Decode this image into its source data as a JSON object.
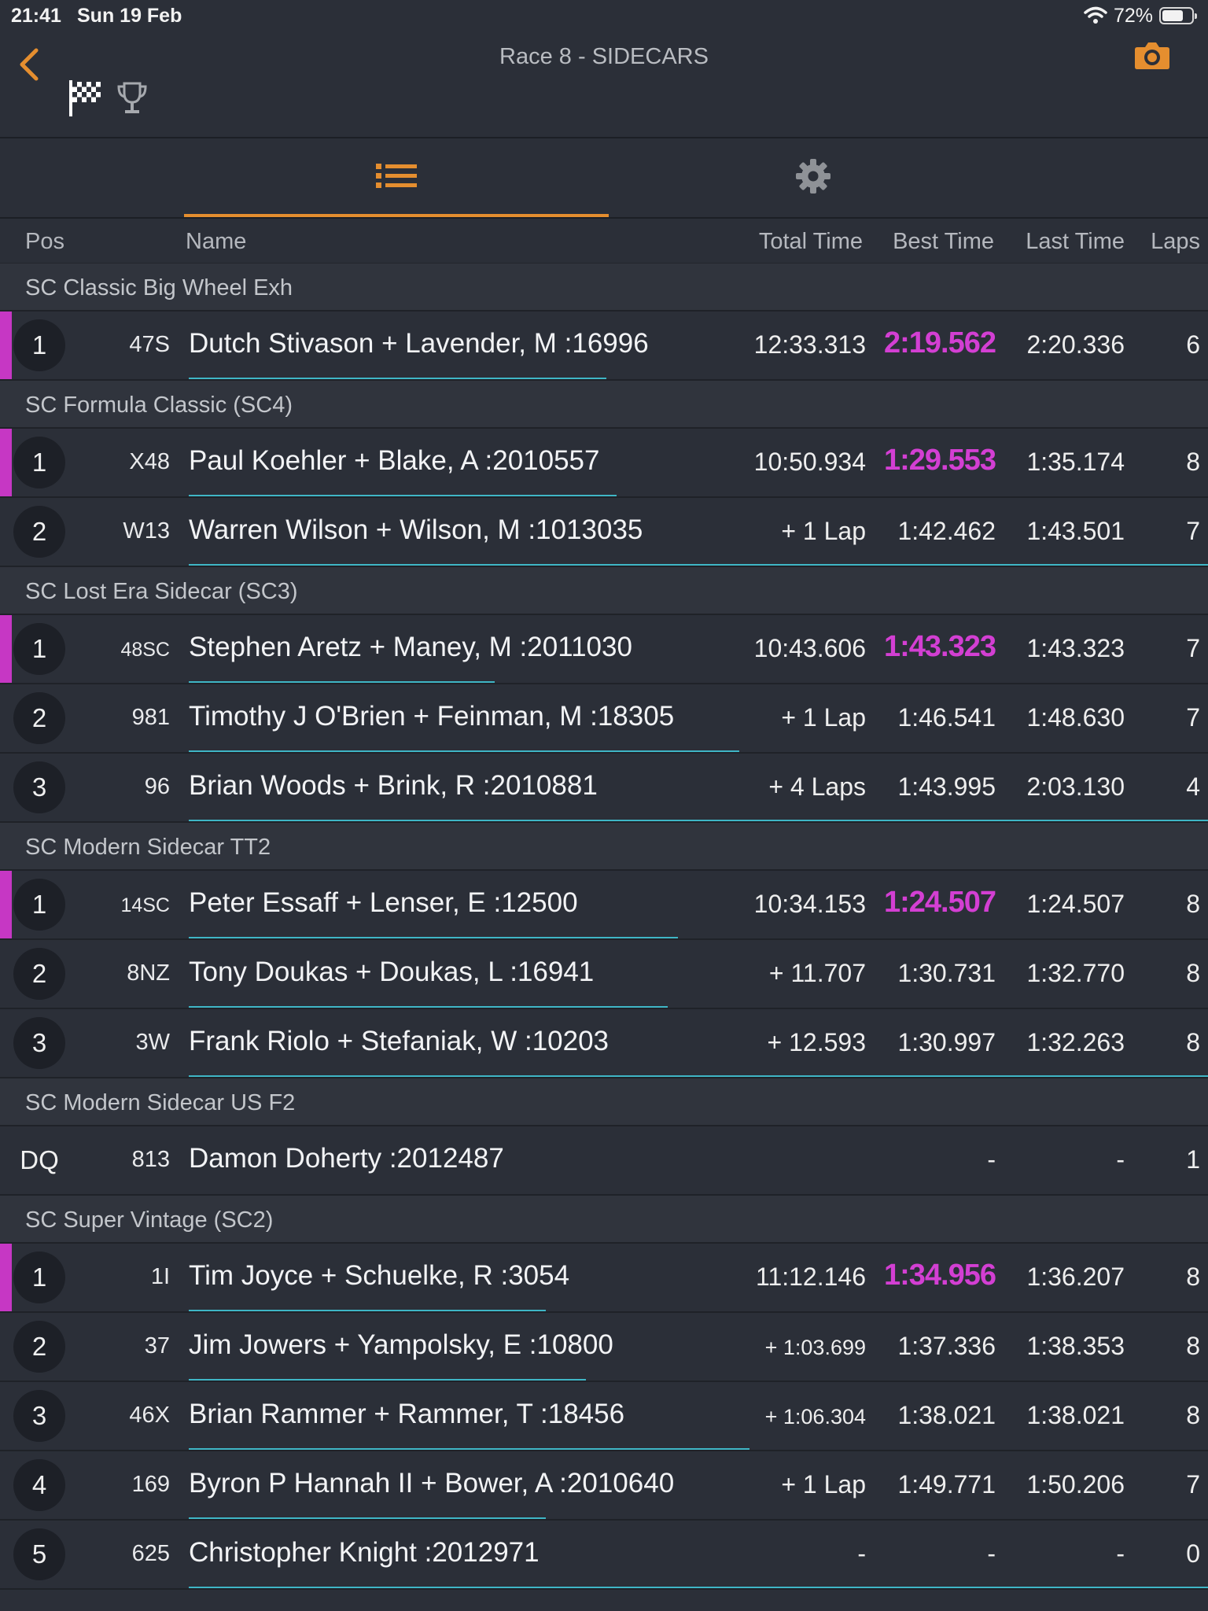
{
  "status": {
    "time": "21:41",
    "date": "Sun 19 Feb",
    "battery": "72%"
  },
  "nav": {
    "title": "Race 8 - SIDECARS"
  },
  "columns": {
    "pos": "Pos",
    "name": "Name",
    "total": "Total Time",
    "best": "Best Time",
    "last": "Last Time",
    "laps": "Laps"
  },
  "colors": {
    "accent": "#e58e2f",
    "best_highlight": "#d33fd3",
    "progress": "#3fb6c6"
  },
  "groups": [
    {
      "name": "SC Classic Big Wheel Exh",
      "rows": [
        {
          "pos": "1",
          "num": "47S",
          "name": "Dutch Stivason + Lavender, M :16996",
          "total": "12:33.313",
          "best": "2:19.562",
          "last": "2:20.336",
          "laps": "6",
          "best_hl": true,
          "progress": 0.41
        }
      ]
    },
    {
      "name": "SC Formula Classic (SC4)",
      "rows": [
        {
          "pos": "1",
          "num": "X48",
          "name": "Paul Koehler + Blake, A :2010557",
          "total": "10:50.934",
          "best": "1:29.553",
          "last": "1:35.174",
          "laps": "8",
          "best_hl": true,
          "progress": 0.42
        },
        {
          "pos": "2",
          "num": "W13",
          "name": "Warren Wilson + Wilson, M :1013035",
          "total": "+ 1 Lap",
          "best": "1:42.462",
          "last": "1:43.501",
          "laps": "7",
          "best_hl": false,
          "progress": 1.0
        }
      ]
    },
    {
      "name": "SC Lost Era Sidecar (SC3)",
      "rows": [
        {
          "pos": "1",
          "num": "48SC",
          "name": "Stephen Aretz + Maney, M :2011030",
          "total": "10:43.606",
          "best": "1:43.323",
          "last": "1:43.323",
          "laps": "7",
          "best_hl": true,
          "progress": 0.3
        },
        {
          "pos": "2",
          "num": "981",
          "name": "Timothy J O'Brien + Feinman, M :18305",
          "total": "+ 1 Lap",
          "best": "1:46.541",
          "last": "1:48.630",
          "laps": "7",
          "best_hl": false,
          "progress": 0.54
        },
        {
          "pos": "3",
          "num": "96",
          "name": "Brian Woods + Brink, R :2010881",
          "total": "+ 4 Laps",
          "best": "1:43.995",
          "last": "2:03.130",
          "laps": "4",
          "best_hl": false,
          "progress": 1.0
        }
      ]
    },
    {
      "name": "SC Modern Sidecar TT2",
      "rows": [
        {
          "pos": "1",
          "num": "14SC",
          "name": "Peter Essaff + Lenser, E :12500",
          "total": "10:34.153",
          "best": "1:24.507",
          "last": "1:24.507",
          "laps": "8",
          "best_hl": true,
          "progress": 0.48
        },
        {
          "pos": "2",
          "num": "8NZ",
          "name": "Tony Doukas + Doukas, L :16941",
          "total": "+ 11.707",
          "best": "1:30.731",
          "last": "1:32.770",
          "laps": "8",
          "best_hl": false,
          "progress": 0.47
        },
        {
          "pos": "3",
          "num": "3W",
          "name": "Frank Riolo + Stefaniak, W :10203",
          "total": "+ 12.593",
          "best": "1:30.997",
          "last": "1:32.263",
          "laps": "8",
          "best_hl": false,
          "progress": 1.0
        }
      ]
    },
    {
      "name": "SC Modern Sidecar US F2",
      "rows": [
        {
          "pos": "DQ",
          "num": "813",
          "name": "Damon Doherty :2012487",
          "total": "",
          "best": "-",
          "last": "-",
          "laps": "1",
          "best_hl": false,
          "progress": 0
        }
      ]
    },
    {
      "name": "SC Super Vintage (SC2)",
      "rows": [
        {
          "pos": "1",
          "num": "1I",
          "name": "Tim Joyce + Schuelke, R :3054",
          "total": "11:12.146",
          "best": "1:34.956",
          "last": "1:36.207",
          "laps": "8",
          "best_hl": true,
          "progress": 0.35
        },
        {
          "pos": "2",
          "num": "37",
          "name": "Jim Jowers + Yampolsky, E :10800",
          "total": "+ 1:03.699",
          "best": "1:37.336",
          "last": "1:38.353",
          "laps": "8",
          "best_hl": false,
          "progress": 0.39
        },
        {
          "pos": "3",
          "num": "46X",
          "name": "Brian Rammer + Rammer, T :18456",
          "total": "+ 1:06.304",
          "best": "1:38.021",
          "last": "1:38.021",
          "laps": "8",
          "best_hl": false,
          "progress": 0.55
        },
        {
          "pos": "4",
          "num": "169",
          "name": "Byron P Hannah II + Bower, A :2010640",
          "total": "+ 1 Lap",
          "best": "1:49.771",
          "last": "1:50.206",
          "laps": "7",
          "best_hl": false,
          "progress": 0.35
        },
        {
          "pos": "5",
          "num": "625",
          "name": "Christopher Knight :2012971",
          "total": "-",
          "best": "-",
          "last": "-",
          "laps": "0",
          "best_hl": false,
          "progress": 1.0
        }
      ]
    }
  ]
}
